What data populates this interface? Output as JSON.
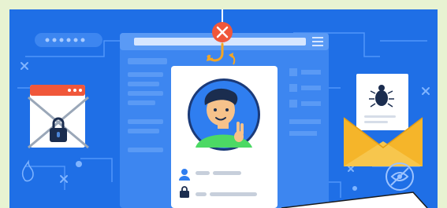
{
  "image": {
    "description_tags": [
      "phishing-hook-icon",
      "profile-card",
      "locked-browser-window",
      "malware-email-envelope",
      "blocked-eye-icon"
    ]
  },
  "colors": {
    "frame_border": "#e8f3d2",
    "background": "#1f6fe6",
    "circuit_lines": "#5ea0ff",
    "browser_window": "#3d86f0",
    "card": "#ffffff",
    "hook": "#f5a623",
    "stop_badge": "#f0573a",
    "avatar_bg": "#2f7ef0",
    "shirt": "#4cd964",
    "envelope": "#f5b52a",
    "lock": "#1b2d4f"
  }
}
